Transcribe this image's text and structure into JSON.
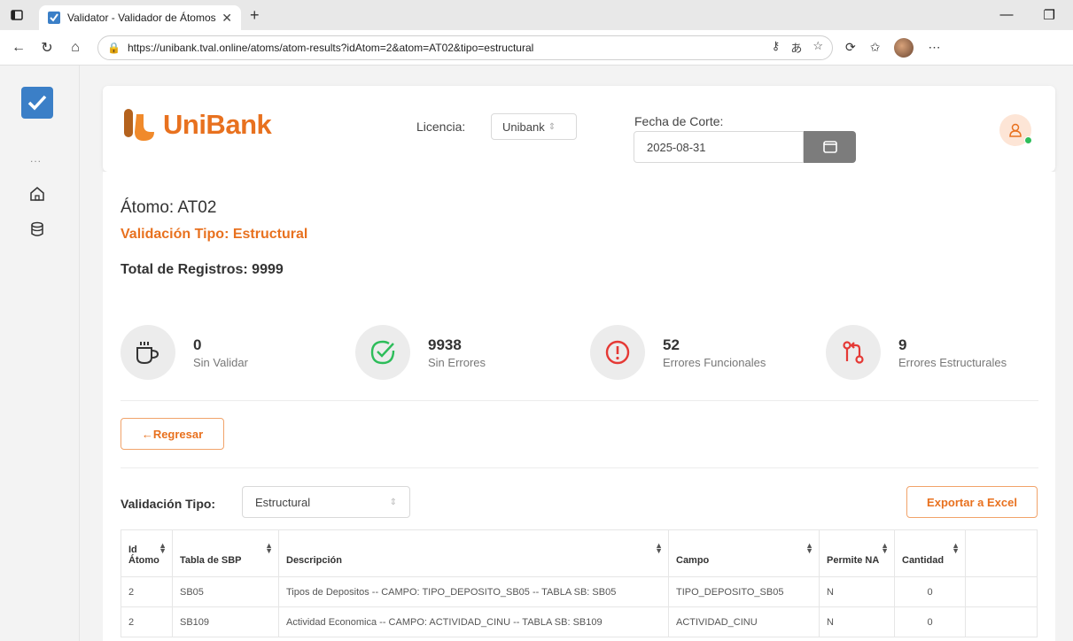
{
  "browser": {
    "tab_title": "Validator - Validador de Átomos",
    "tab_close": "✕",
    "new_tab": "+",
    "url": "https://unibank.tval.online/atoms/atom-results?idAtom=2&atom=AT02&tipo=estructural"
  },
  "header": {
    "brand": "UniBank",
    "license_label": "Licencia:",
    "license_value": "Unibank",
    "cutoff_label": "Fecha de Corte:",
    "cutoff_value": "2025-08-31"
  },
  "sidebar": {
    "dots": "..."
  },
  "atom": {
    "title": "Átomo: AT02",
    "validation_type": "Validación Tipo: Estructural",
    "total": "Total de Registros: 9999"
  },
  "stats": [
    {
      "value": "0",
      "label": "Sin Validar",
      "icon": "cup-icon"
    },
    {
      "value": "9938",
      "label": "Sin Errores",
      "icon": "check-circle-icon"
    },
    {
      "value": "52",
      "label": "Errores Funcionales",
      "icon": "alert-circle-icon"
    },
    {
      "value": "9",
      "label": "Errores Estructurales",
      "icon": "git-compare-icon"
    }
  ],
  "actions": {
    "back": "←Regresar",
    "export": "Exportar a Excel"
  },
  "filter": {
    "label": "Validación Tipo:",
    "value": "Estructural"
  },
  "table": {
    "headers": [
      "Id Átomo",
      "Tabla de SBP",
      "Descripción",
      "Campo",
      "Permite NA",
      "Cantidad"
    ],
    "rows": [
      [
        "2",
        "SB05",
        "Tipos de Depositos -- CAMPO: TIPO_DEPOSITO_SB05 -- TABLA SB: SB05",
        "TIPO_DEPOSITO_SB05",
        "N",
        "0"
      ],
      [
        "2",
        "SB109",
        "Actividad Economica -- CAMPO: ACTIVIDAD_CINU -- TABLA SB: SB109",
        "ACTIVIDAD_CINU",
        "N",
        "0"
      ]
    ]
  },
  "colors": {
    "brand": "#e8711f",
    "success": "#2dbd5a",
    "danger": "#e53935",
    "accent": "#3b7fc7"
  }
}
